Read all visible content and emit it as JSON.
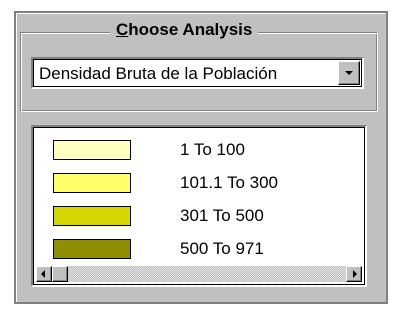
{
  "analysis_group": {
    "title_accel": "C",
    "title_rest": "hoose Analysis"
  },
  "analysis_select": {
    "value": "Densidad Bruta de la Población"
  },
  "legend": {
    "items": [
      {
        "label": "1 To 100",
        "color": "#ffffc0"
      },
      {
        "label": "101.1 To 300",
        "color": "#ffff6a"
      },
      {
        "label": "301 To 500",
        "color": "#d6d600"
      },
      {
        "label": "500 To 971",
        "color": "#8e8e00"
      }
    ]
  },
  "icons": {
    "dropdown": "chevron-down-icon",
    "scroll_left": "arrow-left-icon",
    "scroll_right": "arrow-right-icon"
  }
}
